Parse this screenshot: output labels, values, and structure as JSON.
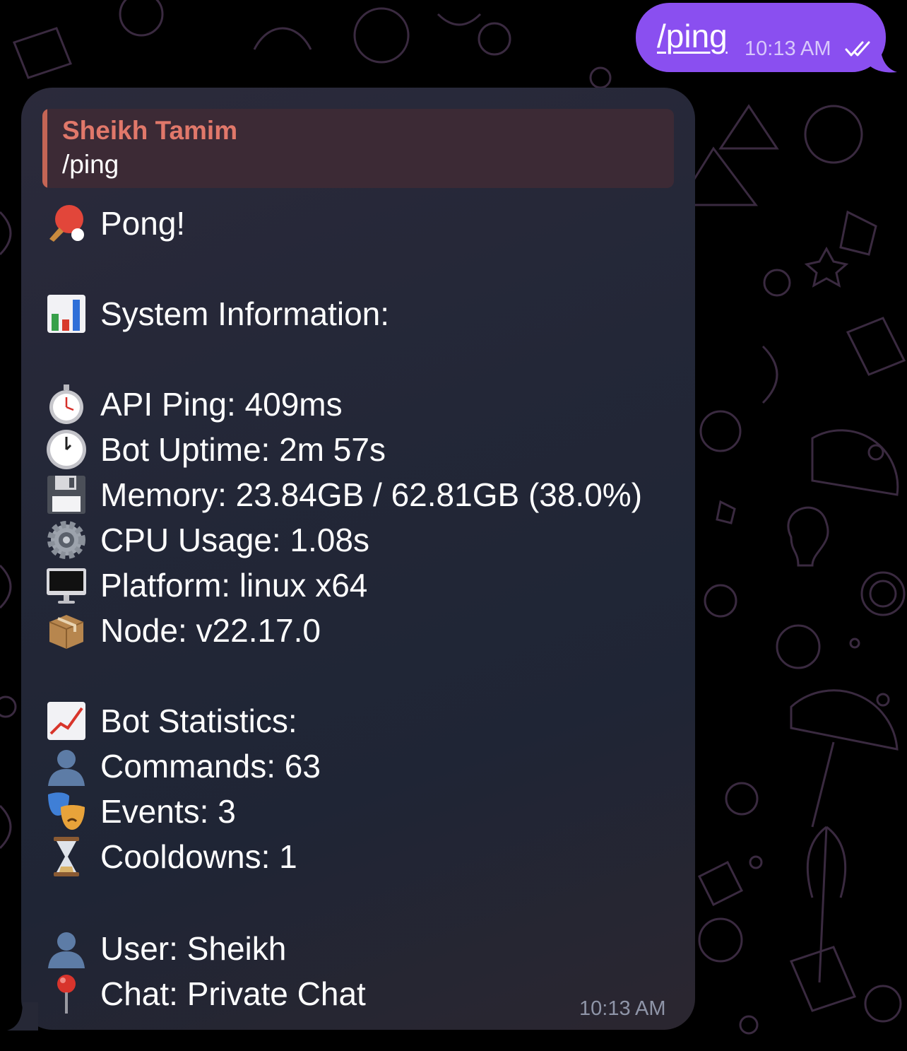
{
  "outgoing": {
    "text": "/ping",
    "time": "10:13 AM",
    "status_icon": "double-check-icon"
  },
  "incoming": {
    "reply": {
      "sender": "Sheikh Tamim",
      "text": "/ping"
    },
    "time": "10:13 AM",
    "lines": [
      {
        "icon": "ping-pong-icon",
        "text": "Pong!"
      },
      {
        "icon": "bar-chart-icon",
        "text": "System Information:"
      },
      {
        "icon": "stopwatch-icon",
        "text": "API Ping: 409ms"
      },
      {
        "icon": "clock-icon",
        "text": "Bot Uptime: 2m 57s"
      },
      {
        "icon": "floppy-disk-icon",
        "text": "Memory: 23.84GB / 62.81GB (38.0%)"
      },
      {
        "icon": "gear-icon",
        "text": "CPU Usage: 1.08s"
      },
      {
        "icon": "desktop-computer-icon",
        "text": "Platform: linux x64"
      },
      {
        "icon": "package-icon",
        "text": "Node: v22.17.0"
      },
      {
        "icon": "trending-up-chart-icon",
        "text": "Bot Statistics:"
      },
      {
        "icon": "user-silhouette-icon",
        "text": "Commands: 63"
      },
      {
        "icon": "theater-masks-icon",
        "text": "Events: 3"
      },
      {
        "icon": "hourglass-icon",
        "text": "Cooldowns: 1"
      },
      {
        "icon": "user-silhouette-icon",
        "text": "User: Sheikh"
      },
      {
        "icon": "round-pushpin-icon",
        "text": "Chat: Private Chat"
      }
    ]
  },
  "colors": {
    "outgoing_bubble": "#8a4ff0",
    "incoming_bubble": "#232737",
    "reply_accent": "#c46555",
    "reply_name": "#e1786a"
  }
}
